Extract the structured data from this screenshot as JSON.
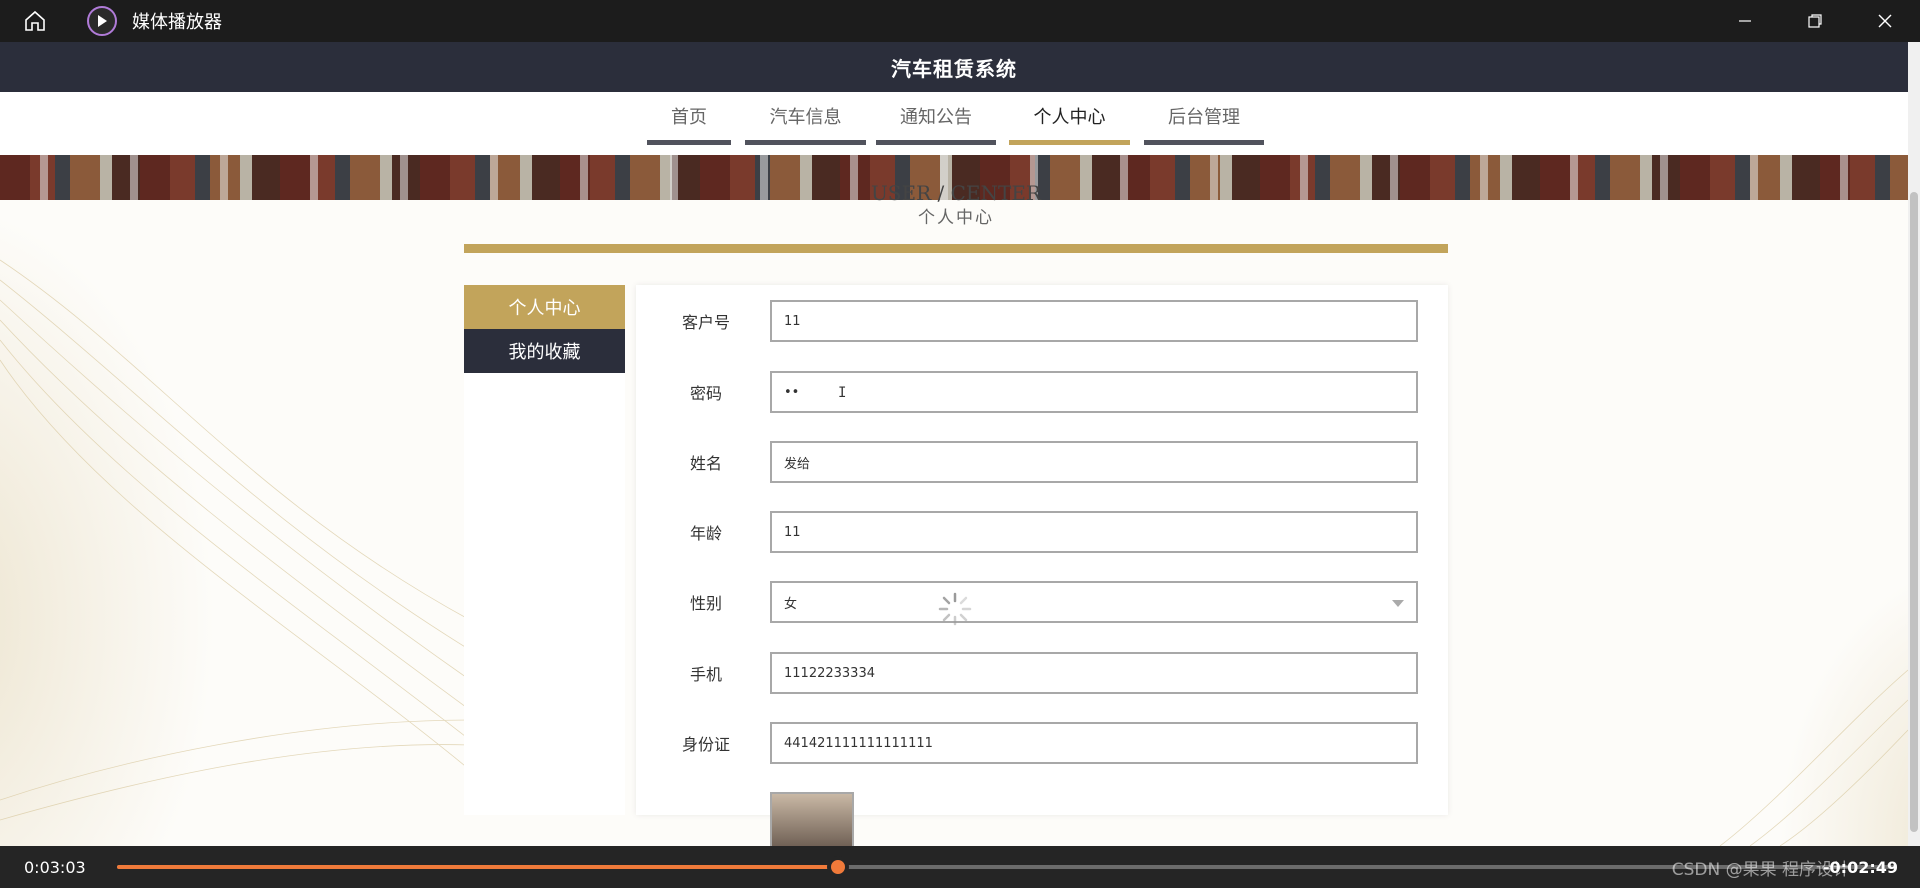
{
  "player": {
    "app_title": "媒体播放器",
    "time_elapsed": "0:03:03",
    "time_remaining": "-0:02:49",
    "progress": 0.405,
    "watermark": "CSDN @果果 程序设计",
    "accent_color": "#f07a3a"
  },
  "site": {
    "title": "汽车租赁系统",
    "header_color": "#2b2e3b",
    "accent_color": "#c2a45b"
  },
  "nav": {
    "items": [
      {
        "label": "首页"
      },
      {
        "label": "汽车信息"
      },
      {
        "label": "通知公告"
      },
      {
        "label": "个人中心",
        "active": true
      },
      {
        "label": "后台管理"
      }
    ]
  },
  "section": {
    "title_en": "USER / CENTER",
    "title_cn": "个人中心"
  },
  "side_menu": {
    "items": [
      {
        "label": "个人中心",
        "active": true
      },
      {
        "label": "我的收藏"
      }
    ]
  },
  "form": {
    "customer_no": {
      "label": "客户号",
      "value": "11"
    },
    "password": {
      "label": "密码",
      "value": "••"
    },
    "name": {
      "label": "姓名",
      "value": "发给"
    },
    "age": {
      "label": "年龄",
      "value": "11"
    },
    "gender": {
      "label": "性别",
      "value": "女"
    },
    "phone": {
      "label": "手机",
      "value": "11122233334"
    },
    "id_card": {
      "label": "身份证",
      "value": "441421111111111111"
    }
  },
  "icons": {
    "home": "home-icon",
    "app": "play-icon",
    "minimize": "minimize-icon",
    "restore": "restore-icon",
    "close": "close-icon",
    "dropdown": "chevron-down-icon",
    "loading": "spinner-icon"
  }
}
